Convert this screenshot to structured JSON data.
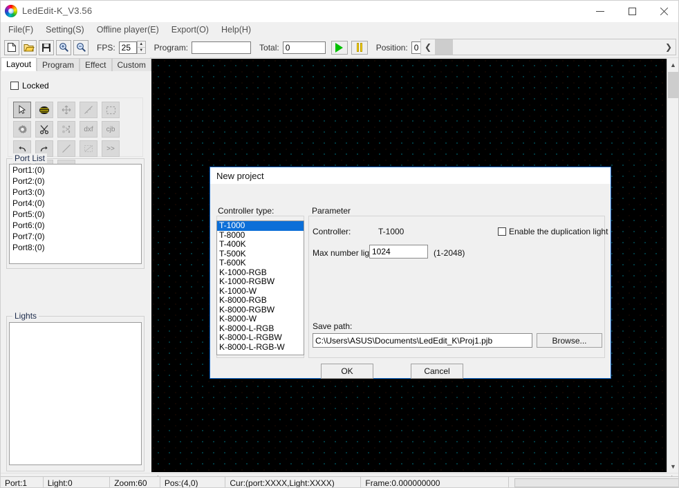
{
  "window": {
    "title": "LedEdit-K_V3.56",
    "logo_icon": "rainbow-spiral-icon",
    "controls": {
      "minimize": "minimize-icon",
      "maximize": "maximize-icon",
      "close": "close-icon"
    }
  },
  "menubar": {
    "items": [
      {
        "label": "File(F)"
      },
      {
        "label": "Setting(S)"
      },
      {
        "label": "Offline player(E)"
      },
      {
        "label": "Export(O)"
      },
      {
        "label": "Help(H)"
      }
    ]
  },
  "toolbar": {
    "buttons": [
      {
        "name": "new-file-icon",
        "glyph": "⎕"
      },
      {
        "name": "open-folder-icon",
        "glyph": "Ὄ2"
      },
      {
        "name": "save-icon",
        "glyph": "ὋE"
      },
      {
        "name": "zoom-in-icon",
        "glyph": "+"
      },
      {
        "name": "zoom-out-icon",
        "glyph": "−"
      }
    ],
    "fps_label": "FPS:",
    "fps_value": "25",
    "program_label": "Program:",
    "program_value": "",
    "total_label": "Total:",
    "total_value": "0",
    "play_icon": "play-icon",
    "pause_icon": "pause-icon",
    "position_label": "Position:",
    "position_value": "0",
    "scroll_left_icon": "chevron-left-icon",
    "scroll_right_icon": "chevron-right-icon"
  },
  "left_panel": {
    "tabs": [
      {
        "label": "Layout",
        "active": true
      },
      {
        "label": "Program",
        "active": false
      },
      {
        "label": "Effect",
        "active": false
      },
      {
        "label": "Custom",
        "active": false
      }
    ],
    "tab_prev_icon": "triangle-left-icon",
    "tab_next_icon": "triangle-right-icon",
    "locked_label": "Locked",
    "locked_checked": false,
    "tools": [
      {
        "name": "select-arrow-icon",
        "glyph": "↖",
        "state": "selected"
      },
      {
        "name": "layout-lines-icon",
        "glyph": "≡",
        "state": "enabled"
      },
      {
        "name": "move-icon",
        "glyph": "✥",
        "state": "disabled"
      },
      {
        "name": "diagonal-line-icon",
        "glyph": "╲",
        "state": "disabled"
      },
      {
        "name": "marquee-select-icon",
        "glyph": "⬚",
        "state": "disabled"
      },
      {
        "name": "settings-gear-icon",
        "glyph": "⚙",
        "state": "enabled"
      },
      {
        "name": "scissors-icon",
        "glyph": "✂",
        "state": "enabled"
      },
      {
        "name": "scatter-cut-icon",
        "glyph": "❃",
        "state": "disabled"
      },
      {
        "name": "dxf-import-icon",
        "glyph": "dxf",
        "state": "disabled"
      },
      {
        "name": "cjb-import-icon",
        "glyph": "cjb",
        "state": "disabled"
      },
      {
        "name": "undo-icon",
        "glyph": "↶",
        "state": "enabled"
      },
      {
        "name": "redo-icon",
        "glyph": "↷",
        "state": "enabled"
      },
      {
        "name": "line-tool-icon",
        "glyph": "╲",
        "state": "disabled"
      },
      {
        "name": "rect-select-icon",
        "glyph": "◱",
        "state": "disabled"
      },
      {
        "name": "forward-icon",
        "glyph": "≫",
        "state": "disabled"
      },
      {
        "name": "text-tool-icon",
        "glyph": "T",
        "state": "disabled"
      },
      {
        "name": "add-icon",
        "glyph": "+",
        "state": "enabled"
      },
      {
        "name": "remove-icon",
        "glyph": "−",
        "state": "enabled"
      }
    ],
    "port_list": {
      "title": "Port List",
      "items": [
        {
          "label": "Port1:(0)"
        },
        {
          "label": "Port2:(0)"
        },
        {
          "label": "Port3:(0)"
        },
        {
          "label": "Port4:(0)"
        },
        {
          "label": "Port5:(0)"
        },
        {
          "label": "Port6:(0)"
        },
        {
          "label": "Port7:(0)"
        },
        {
          "label": "Port8:(0)"
        }
      ]
    },
    "lights": {
      "title": "Lights",
      "items": []
    }
  },
  "canvas": {
    "grid_dot_color": "#00e5ff",
    "background_color": "#000000",
    "grid_spacing_px": 16,
    "scroll_up_icon": "chevron-up-icon",
    "scroll_down_icon": "chevron-down-icon"
  },
  "dialog": {
    "title": "New project",
    "controller_group_label": "Controller type:",
    "controller_types": [
      {
        "label": "T-1000",
        "selected": true
      },
      {
        "label": "T-8000",
        "selected": false
      },
      {
        "label": "T-400K",
        "selected": false
      },
      {
        "label": "T-500K",
        "selected": false
      },
      {
        "label": "T-600K",
        "selected": false
      },
      {
        "label": "K-1000-RGB",
        "selected": false
      },
      {
        "label": "K-1000-RGBW",
        "selected": false
      },
      {
        "label": "K-1000-W",
        "selected": false
      },
      {
        "label": "K-8000-RGB",
        "selected": false
      },
      {
        "label": "K-8000-RGBW",
        "selected": false
      },
      {
        "label": "K-8000-W",
        "selected": false
      },
      {
        "label": "K-8000-L-RGB",
        "selected": false
      },
      {
        "label": "K-8000-L-RGBW",
        "selected": false
      },
      {
        "label": "K-8000-L-RGB-W",
        "selected": false
      }
    ],
    "parameter_group_label": "Parameter",
    "controller_label": "Controller:",
    "controller_value": "T-1000",
    "duplication_label": "Enable the duplication light",
    "duplication_checked": false,
    "max_light_label": "Max number light",
    "max_light_value": "1024",
    "max_light_range": "(1-2048)",
    "save_path_label": "Save path:",
    "save_path_value": "C:\\Users\\ASUS\\Documents\\LedEdit_K\\Proj1.pjb",
    "browse_label": "Browse...",
    "ok_label": "OK",
    "cancel_label": "Cancel",
    "accent_color": "#0c6fd8"
  },
  "statusbar": {
    "port": "Port:1",
    "light": "Light:0",
    "zoom": "Zoom:60",
    "pos": "Pos:(4,0)",
    "cur": "Cur:(port:XXXX,Light:XXXX)",
    "frame": "Frame:0.000000000"
  }
}
